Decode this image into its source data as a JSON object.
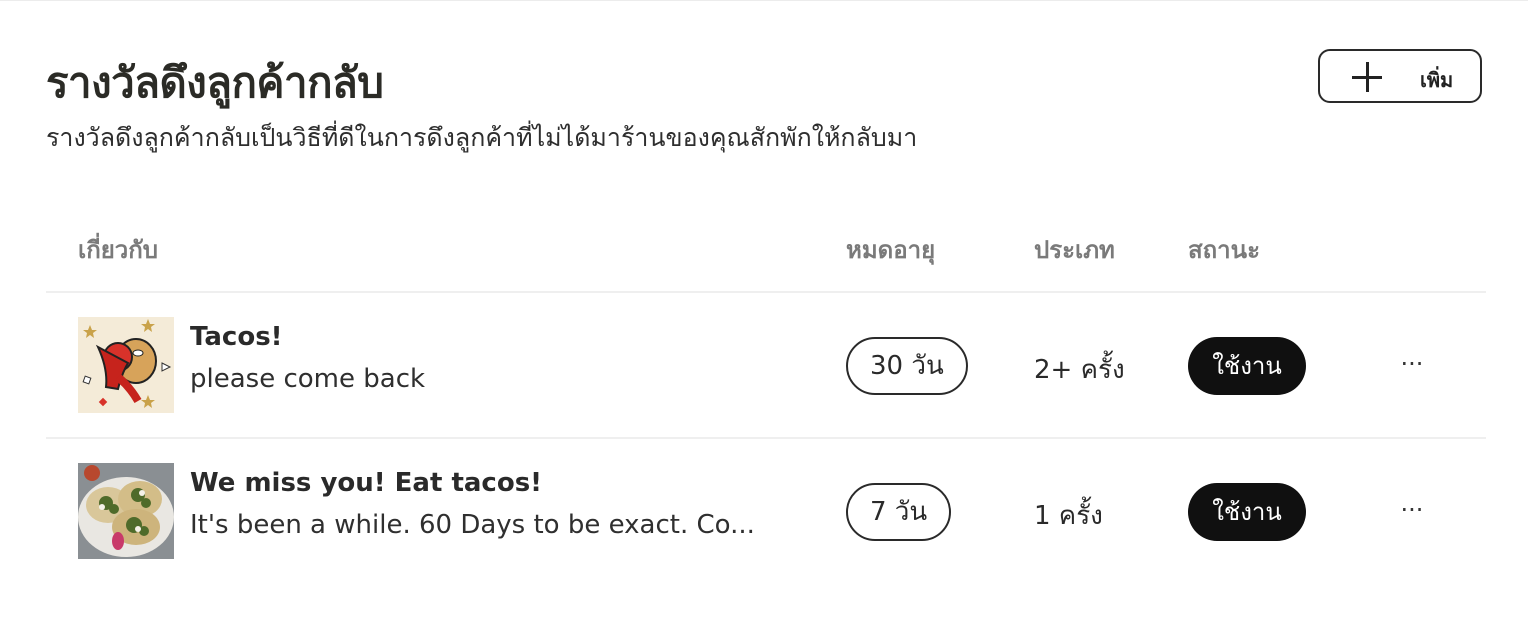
{
  "header": {
    "title": "รางวัลดึงลูกค้ากลับ",
    "subtitle": "รางวัลดึงลูกค้ากลับเป็นวิธีที่ดีในการดึงลูกค้าที่ไม่ได้มาร้านของคุณสักพักให้กลับมา",
    "add_button_label": "เพิ่ม"
  },
  "table": {
    "columns": {
      "about": "เกี่ยวกับ",
      "expiry": "หมดอายุ",
      "type": "ประเภท",
      "status": "สถานะ"
    },
    "rows": [
      {
        "name": "Tacos!",
        "message": "please come back",
        "expiry": "30 วัน",
        "type": "2+ ครั้ง",
        "status": "ใช้งาน",
        "more": "···",
        "thumbnail_icon": "cartoon-illustration-icon"
      },
      {
        "name": "We miss you! Eat tacos!",
        "message": "It's been a while. 60 Days to be exact. Co...",
        "expiry": "7 วัน",
        "type": "1 ครั้ง",
        "status": "ใช้งาน",
        "more": "···",
        "thumbnail_icon": "tacos-photo-icon"
      }
    ]
  },
  "colors": {
    "status_bg": "#101010",
    "header_text": "#7a7a7a",
    "border": "#2a2a2a"
  }
}
